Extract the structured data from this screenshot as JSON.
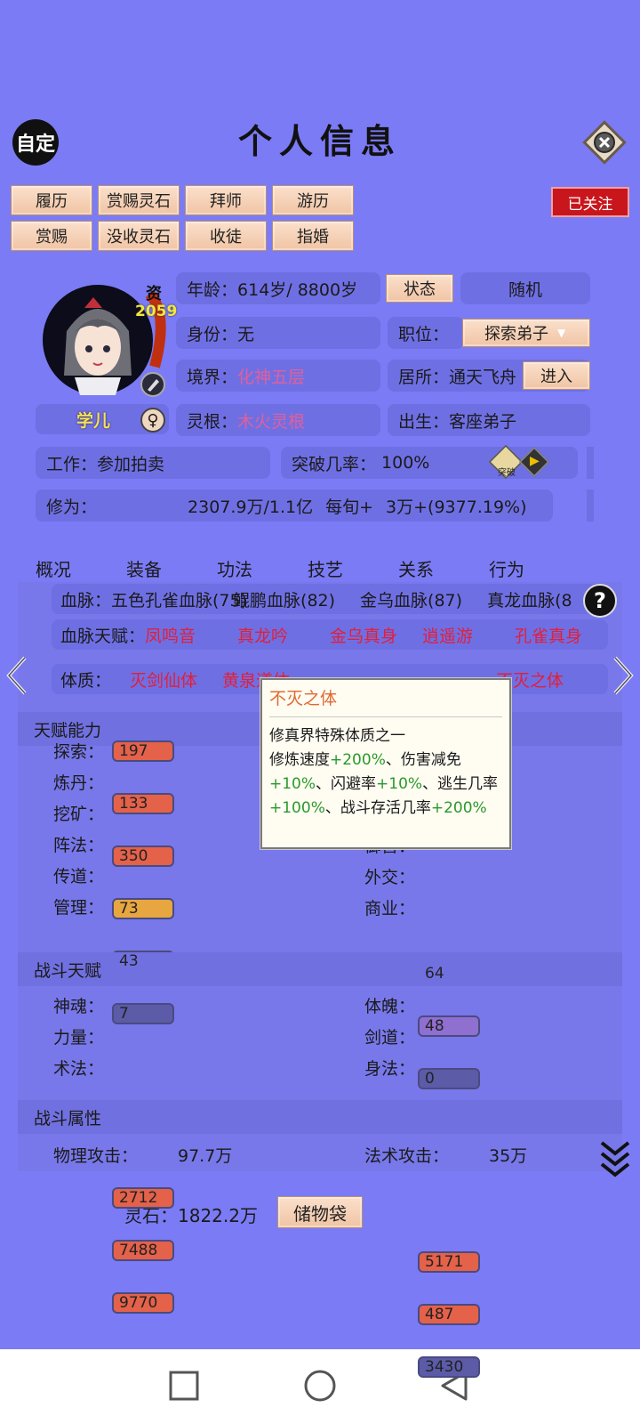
{
  "header": {
    "title": "个人信息",
    "custom_label": "自定"
  },
  "actions": {
    "row1": [
      "履历",
      "赏赐灵石",
      "拜师",
      "游历"
    ],
    "row2": [
      "赏赐",
      "没收灵石",
      "收徒",
      "指婚"
    ],
    "follow_label": "已关注"
  },
  "character": {
    "name": "学儿",
    "aptitude_label": "资",
    "aptitude_value": "2059",
    "age_key": "年龄：",
    "age_value": "614岁/ 8800岁",
    "status_button": "状态",
    "random_button": "随机",
    "identity_key": "身份：",
    "identity_value": "无",
    "position_key": "职位：",
    "position_value": "探索弟子",
    "realm_key": "境界：",
    "realm_value": "化神五层",
    "residence_key": "居所：",
    "residence_value": "通天飞舟",
    "enter_button": "进入",
    "root_key": "灵根：",
    "root_value": "木火灵根",
    "birth_key": "出生：",
    "birth_value": "客座弟子",
    "work_key": "工作：",
    "work_value": "参加拍卖",
    "breakthrough_key": "突破几率：",
    "breakthrough_value": "100%",
    "breakthrough_icon_label": "突破",
    "cultivation_key": "修为：",
    "cultivation_value": "2307.9万/1.1亿",
    "per_turn_key": "每旬+",
    "per_turn_value": "3万+(9377.19%)"
  },
  "tabs": [
    "概况",
    "装备",
    "功法",
    "技艺",
    "关系",
    "行为"
  ],
  "bloodline": {
    "key": "血脉：",
    "items": [
      "五色孔雀血脉(75)",
      "鲲鹏血脉(82)",
      "金乌血脉(87)",
      "真龙血脉(8"
    ]
  },
  "bloodline_talent": {
    "key": "血脉天赋：",
    "items": [
      "凤鸣音",
      "真龙吟",
      "金乌真身",
      "逍遥游",
      "孔雀真身"
    ]
  },
  "physique": {
    "key": "体质：",
    "items": [
      "灭剑仙体",
      "黄泉道体",
      "",
      "",
      "不灭之体"
    ]
  },
  "tooltip": {
    "title": "不灭之体",
    "line1": "修真界特殊体质之一",
    "seg1": "修炼速度",
    "val1": "+200%",
    "seg2": "、伤害减免",
    "val2": "+10%",
    "seg3": "、闪避率",
    "val3": "+10%",
    "seg4": "、逃生几率",
    "val4": "+100%",
    "seg5": "、战斗存活几率",
    "val5": "+200%"
  },
  "talent_abilities": {
    "title": "天赋能力",
    "left": [
      {
        "label": "探索：",
        "value": "197",
        "color": "#e4614a"
      },
      {
        "label": "炼丹：",
        "value": "133",
        "color": "#e4614a"
      },
      {
        "label": "挖矿：",
        "value": "350",
        "color": "#e4614a"
      },
      {
        "label": "阵法：",
        "value": "73",
        "color": "#e8a640"
      },
      {
        "label": "传道：",
        "value": "43",
        "color": "#8f6fd0"
      },
      {
        "label": "管理：",
        "value": "7",
        "color": "#5b5ba8"
      }
    ],
    "right": [
      {
        "label": "御兽：",
        "value": "64",
        "color": "#e8a640"
      },
      {
        "label": "外交：",
        "value": "48",
        "color": "#8f6fd0"
      },
      {
        "label": "商业：",
        "value": "0",
        "color": "#5b5ba8"
      }
    ]
  },
  "combat_talent": {
    "title": "战斗天赋",
    "left": [
      {
        "label": "神魂：",
        "value": "2712",
        "color": "#e4614a"
      },
      {
        "label": "力量：",
        "value": "7488",
        "color": "#e4614a"
      },
      {
        "label": "术法：",
        "value": "9770",
        "color": "#e4614a"
      }
    ],
    "right": [
      {
        "label": "体魄：",
        "value": "5171",
        "color": "#e4614a"
      },
      {
        "label": "剑道：",
        "value": "487",
        "color": "#e4614a"
      },
      {
        "label": "身法：",
        "value": "3430",
        "color": "#5b5ba8"
      }
    ]
  },
  "combat_attributes": {
    "title": "战斗属性",
    "phys_attack_key": "物理攻击：",
    "phys_attack_value": "97.7万",
    "magic_attack_key": "法术攻击：",
    "magic_attack_value": "35万"
  },
  "footer": {
    "spirit_stone_key": "灵石：",
    "spirit_stone_value": "1822.2万",
    "storage_button": "储物袋"
  }
}
